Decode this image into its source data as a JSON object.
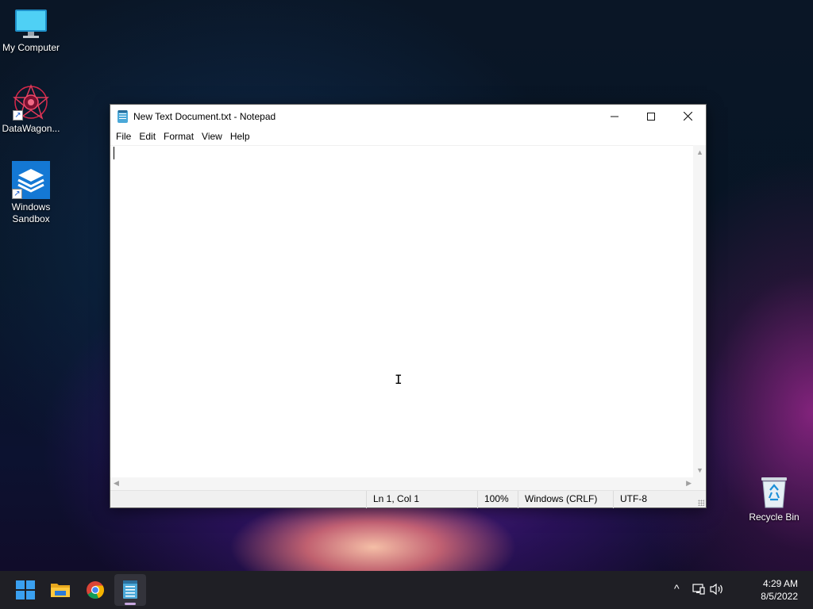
{
  "desktop": {
    "icons": [
      {
        "name": "my-computer",
        "label": "My Computer"
      },
      {
        "name": "datawagon",
        "label": "DataWagon..."
      },
      {
        "name": "windows-sandbox",
        "label_line1": "Windows",
        "label_line2": "Sandbox"
      },
      {
        "name": "recycle-bin",
        "label": "Recycle Bin"
      }
    ]
  },
  "notepad": {
    "title": "New Text Document.txt - Notepad",
    "controls": {
      "minimize": "—",
      "maximize": "☐",
      "close": "✕"
    },
    "menu": [
      "File",
      "Edit",
      "Format",
      "View",
      "Help"
    ],
    "content": "",
    "status": {
      "position": "Ln 1, Col 1",
      "zoom": "100%",
      "line_ending": "Windows (CRLF)",
      "encoding": "UTF-8"
    }
  },
  "taskbar": {
    "apps": [
      {
        "name": "start",
        "icon": "windows-logo"
      },
      {
        "name": "file-explorer",
        "icon": "folder-icon"
      },
      {
        "name": "chrome",
        "icon": "chrome-icon"
      },
      {
        "name": "notepad",
        "icon": "notepad-icon",
        "active": true
      }
    ],
    "tray": {
      "chevron": "^",
      "time": "4:29 AM",
      "date": "8/5/2022"
    }
  },
  "colors": {
    "accent": "#0078d4",
    "taskbar": "#1f1f25",
    "statusbar": "#f0f0f0"
  }
}
